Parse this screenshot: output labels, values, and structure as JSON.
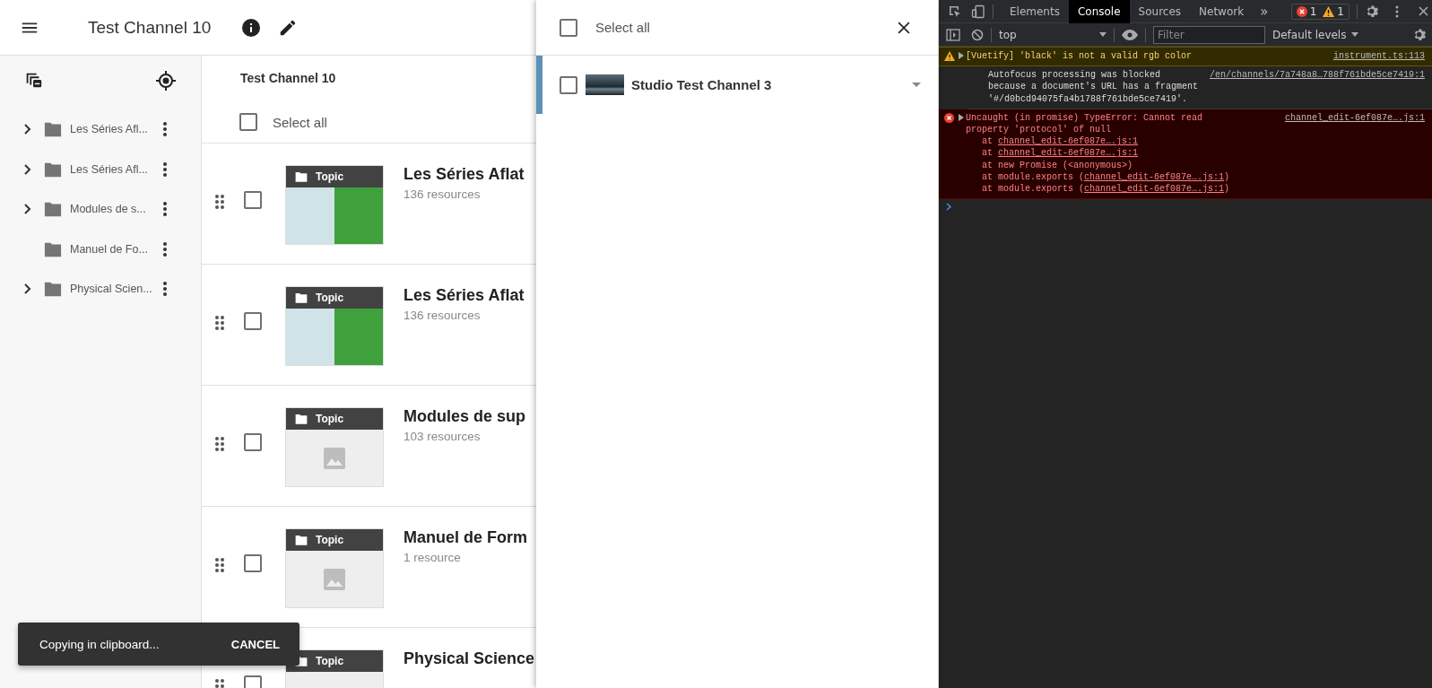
{
  "app_bar": {
    "title": "Test Channel 10"
  },
  "sidebar": {
    "items": [
      {
        "label": "Les Séries Afl...",
        "expandable": true
      },
      {
        "label": "Les Séries Afl...",
        "expandable": true
      },
      {
        "label": "Modules de s...",
        "expandable": true
      },
      {
        "label": "Manuel de Fo...",
        "expandable": false
      },
      {
        "label": "Physical Scien...",
        "expandable": true
      }
    ]
  },
  "content": {
    "heading": "Test Channel 10",
    "select_all": {
      "label": "Select all",
      "checked": false
    },
    "rows": [
      {
        "kind": "photo",
        "title": "Les Séries Aflat",
        "subtitle": "136 resources",
        "tag": "Topic",
        "checked": false
      },
      {
        "kind": "photo",
        "title": "Les Séries Aflat",
        "subtitle": "136 resources",
        "tag": "Topic",
        "checked": false
      },
      {
        "kind": "placeholder",
        "title": "Modules de sup",
        "subtitle": "103 resources",
        "tag": "Topic",
        "checked": false
      },
      {
        "kind": "placeholder",
        "title": "Manuel de Form",
        "subtitle": "1 resource",
        "tag": "Topic",
        "checked": false
      },
      {
        "kind": "placeholder",
        "title": "Physical Science",
        "tag": "Topic",
        "checked": false
      }
    ]
  },
  "clipboard_panel": {
    "select_all": {
      "label": "Select all",
      "checked": false
    },
    "channels": [
      {
        "name": "Studio Test Channel 3",
        "checked": false,
        "selected": true
      }
    ]
  },
  "snackbar": {
    "message": "Copying in clipboard...",
    "action": "CANCEL"
  },
  "devtools": {
    "tabs": [
      {
        "label": "Elements",
        "selected": false
      },
      {
        "label": "Console",
        "selected": true
      },
      {
        "label": "Sources",
        "selected": false
      },
      {
        "label": "Network",
        "selected": false
      }
    ],
    "more": "»",
    "error_count": "1",
    "warning_count": "1",
    "context": "top",
    "filter": {
      "placeholder": "Filter"
    },
    "levels": "Default levels",
    "messages": [
      {
        "kind": "warning",
        "text": "[Vuetify] 'black' is not a valid rgb color",
        "source": "instrument.ts:113",
        "expandable": true
      },
      {
        "kind": "info",
        "text": "Autofocus processing was blocked\nbecause a document's URL has a fragment\n'#/d0bcd94075fa4b1788f761bde5ce7419'.",
        "source": "/en/channels/7a748a8…788f761bde5ce7419:1",
        "expandable": false
      },
      {
        "kind": "error",
        "text": "Uncaught (in promise) TypeError: Cannot read\nproperty 'protocol' of null",
        "source": "channel_edit-6ef087e….js:1",
        "expandable": true,
        "stack": [
          {
            "prefix": "at ",
            "link": "channel_edit-6ef087e….js:1"
          },
          {
            "prefix": "at ",
            "link": "channel_edit-6ef087e….js:1"
          },
          {
            "prefix": "at new Promise (<anonymous>)"
          },
          {
            "prefix": "at module.exports (",
            "link": "channel_edit-6ef087e….js:1",
            "suffix": ")"
          },
          {
            "prefix": "at module.exports (",
            "link": "channel_edit-6ef087e….js:1",
            "suffix": ")"
          }
        ]
      }
    ]
  }
}
